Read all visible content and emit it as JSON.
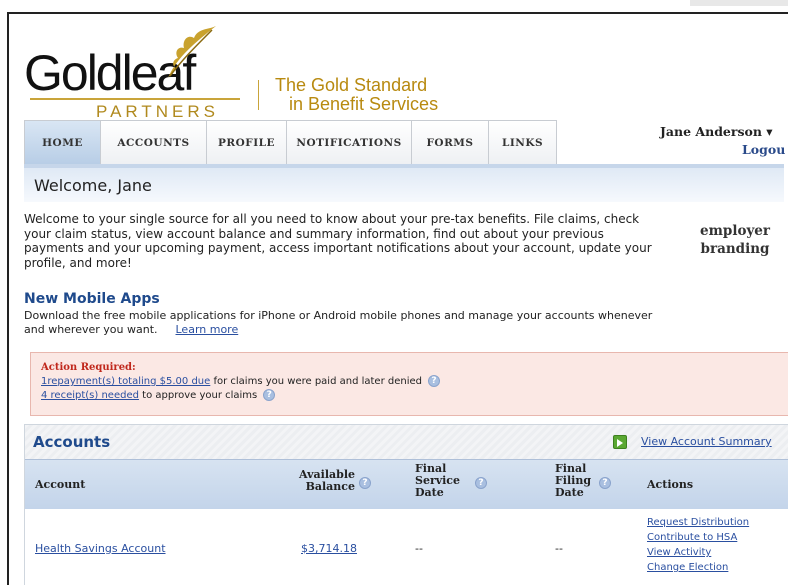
{
  "brand": {
    "logo_word": "Goldleaf",
    "logo_sub": "PARTNERS",
    "tagline_1": "The Gold Standard",
    "tagline_2": "in Benefit Services"
  },
  "nav": {
    "tabs": [
      "HOME",
      "ACCOUNTS",
      "PROFILE",
      "NOTIFICATIONS",
      "FORMS",
      "LINKS"
    ],
    "active_tab": "HOME"
  },
  "user": {
    "name": "Jane Anderson ▾",
    "logout": "Logou"
  },
  "welcome": {
    "title": "Welcome, Jane",
    "text": "Welcome to your single source for all you need to know about your pre-tax benefits. File claims, check your claim status, view account balance and summary information, find out about your previous payments and your upcoming payment, access important notifications about your account, update your profile, and more!",
    "employer_1": "employer",
    "employer_2": "branding"
  },
  "mobile": {
    "title": "New Mobile Apps",
    "text": "Download the free mobile applications for iPhone or Android mobile phones and manage your accounts whenever and wherever you want.",
    "link": "Learn more"
  },
  "action": {
    "title": "Action Required:",
    "line1_link": "1repayment(s) totaling $5.00 due",
    "line1_text": " for claims you were paid and later denied",
    "line2_link": "4 receipt(s) needed",
    "line2_text": " to approve your claims",
    "help_glyph": "?"
  },
  "accounts": {
    "title": "Accounts",
    "summary_link": "View Account Summary",
    "headers": {
      "account": "Account",
      "balance_1": "Available",
      "balance_2": "Balance",
      "service_1": "Final",
      "service_2": "Service",
      "service_3": "Date",
      "filing_1": "Final",
      "filing_2": "Filing",
      "filing_3": "Date",
      "actions": "Actions"
    },
    "rows": [
      {
        "account": "Health Savings Account",
        "balance": "$3,714.18",
        "service_date": "--",
        "filing_date": "--",
        "actions": [
          "Request Distribution",
          "Contribute to HSA",
          "View Activity",
          "Change Election"
        ]
      }
    ]
  },
  "colors": {
    "brand_gold": "#b88a10",
    "link_blue": "#2a4fa0",
    "heading_blue": "#1f4a8c",
    "alert_red": "#c0281c",
    "alert_bg": "#fbe8e4"
  }
}
